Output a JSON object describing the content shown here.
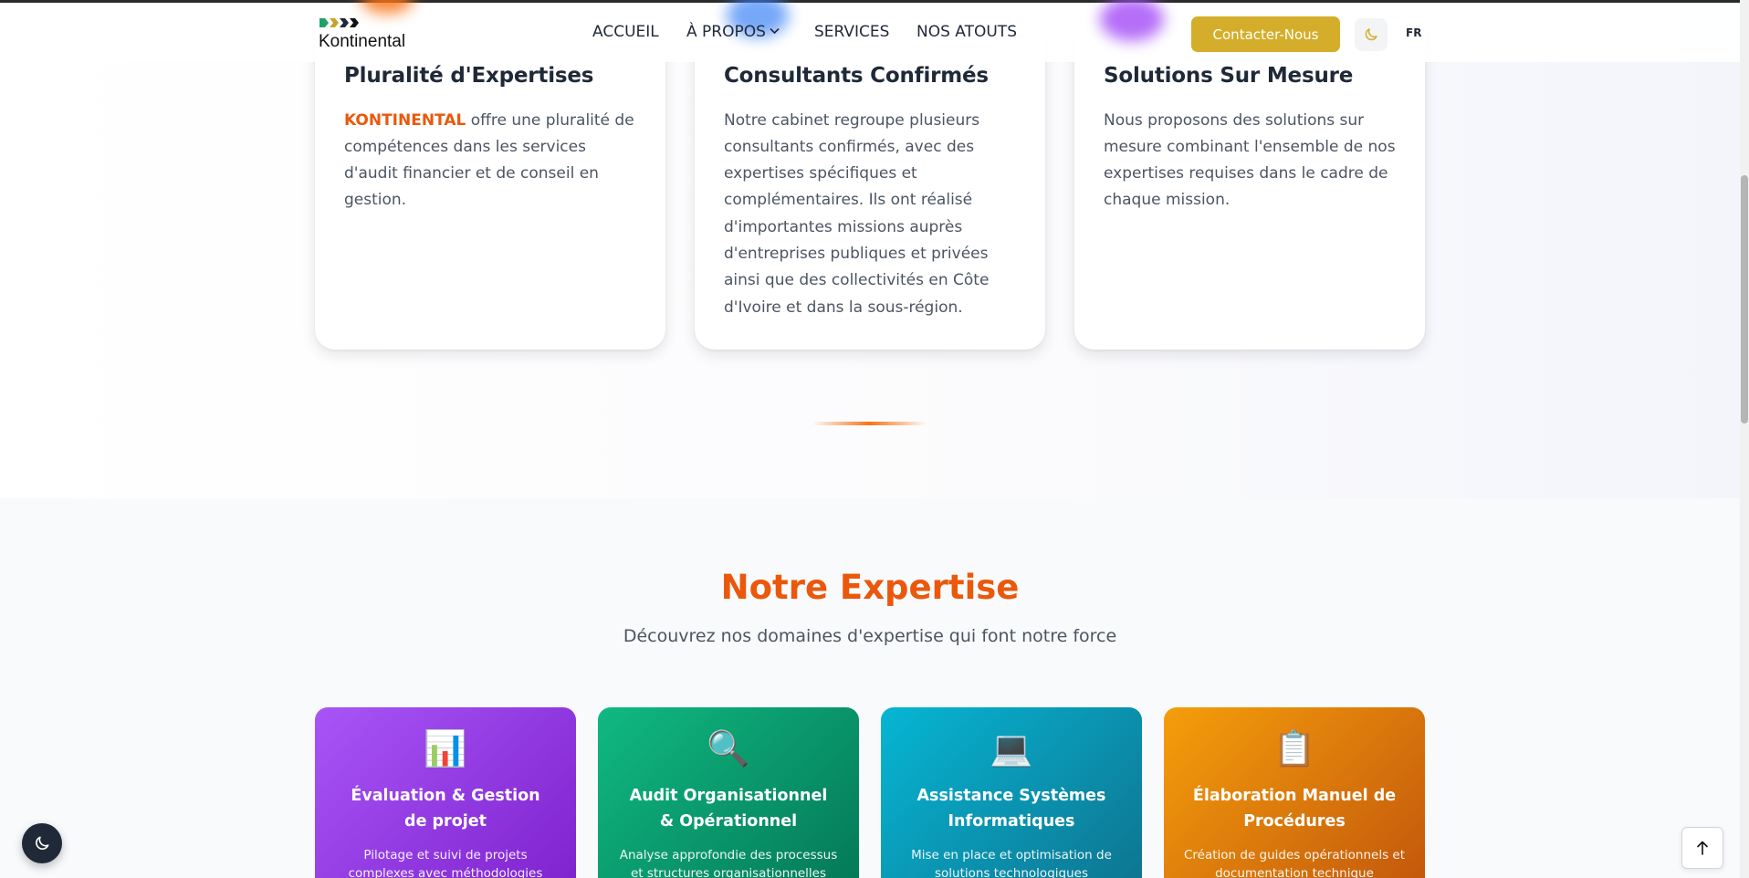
{
  "brand": {
    "name": "Kontinental"
  },
  "nav": {
    "items": [
      {
        "label": "ACCUEIL"
      },
      {
        "label": "À PROPOS"
      },
      {
        "label": "SERVICES"
      },
      {
        "label": "NOS ATOUTS"
      }
    ],
    "contact_label": "Contacter-Nous",
    "language": "FR"
  },
  "atouts": [
    {
      "title": "Pluralité d'Expertises",
      "highlight": "KONTINENTAL",
      "text": " offre une pluralité de compétences dans les services d'audit financier et de conseil en gestion."
    },
    {
      "title": "Consultants Confirmés",
      "text": "Notre cabinet regroupe plusieurs consultants confirmés, avec des expertises spécifiques et complémentaires. Ils ont réalisé d'importantes missions auprès d'entreprises publiques et privées ainsi que des collectivités en Côte d'Ivoire et dans la sous-région."
    },
    {
      "title": "Solutions Sur Mesure",
      "text": "Nous proposons des solutions sur mesure combinant l'ensemble de nos expertises requises dans le cadre de chaque mission."
    }
  ],
  "expertise": {
    "title": "Notre Expertise",
    "subtitle": "Découvrez nos domaines d'expertise qui font notre force",
    "cards": [
      {
        "icon": "📊",
        "title": "Évaluation & Gestion de projet",
        "text": "Pilotage et suivi de projets complexes avec méthodologies éprouvées"
      },
      {
        "icon": "🔍",
        "title": "Audit Organisationnel & Opérationnel",
        "text": "Analyse approfondie des processus et structures organisationnelles"
      },
      {
        "icon": "💻",
        "title": "Assistance Systèmes Informatiques",
        "text": "Mise en place et optimisation de solutions technologiques"
      },
      {
        "icon": "📋",
        "title": "Élaboration Manuel de Procédures",
        "text": "Création de guides opérationnels et documentation technique"
      }
    ]
  },
  "colors": {
    "accent": "#ea580c",
    "button": "#d4ae2a"
  }
}
